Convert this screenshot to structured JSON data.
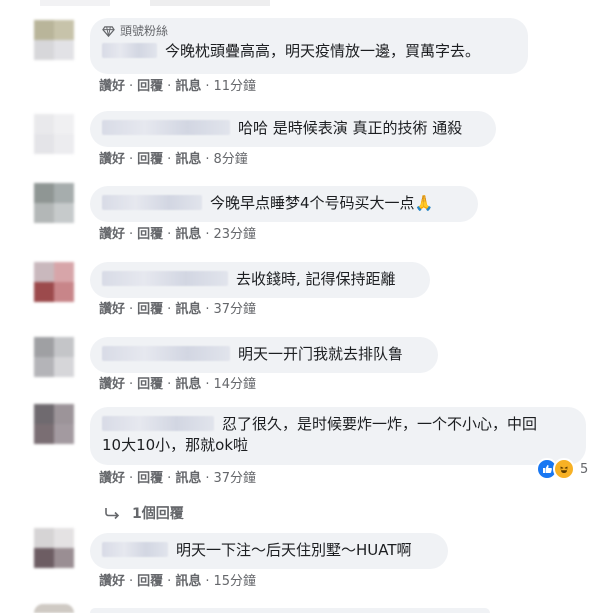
{
  "actions": {
    "like": "讚好",
    "reply": "回覆",
    "message": "訊息",
    "sep": "·"
  },
  "comments": [
    {
      "badge": "頭號粉絲",
      "text": "今晚枕頭疊高高，明天疫情放一邊，買萬字去。",
      "time": "11分鐘",
      "avatar_colors": [
        "#b9b59a",
        "#c7c3aa",
        "#d7d7da",
        "#e2e2e6"
      ]
    },
    {
      "text": "哈哈 是時候表演 真正的技術 通殺",
      "time": "8分鐘",
      "avatar_colors": [
        "#e9e9ec",
        "#f0f0f2",
        "#e4e4e8",
        "#ececef"
      ]
    },
    {
      "text": "今晚早点睡梦4个号码买大一点🙏",
      "time": "23分鐘",
      "avatar_colors": [
        "#8f9694",
        "#a6adad",
        "#b3b7b7",
        "#c6cacb"
      ]
    },
    {
      "text": "去收錢時, 記得保持距離",
      "time": "37分鐘",
      "avatar_colors": [
        "#c9b8bd",
        "#d7a5a9",
        "#9c4a4c",
        "#c88589"
      ]
    },
    {
      "text": "明天一开门我就去排队鲁",
      "time": "14分鐘",
      "avatar_colors": [
        "#9fa0a3",
        "#c4c5c8",
        "#b4b4b8",
        "#d6d6d9"
      ]
    },
    {
      "text_line1": "忍了很久，是时候要炸一炸，一个不小心，中回",
      "text_line2": "10大10小，那就ok啦",
      "time": "37分鐘",
      "avatar_colors": [
        "#6f6a6f",
        "#9c9499",
        "#7a6e73",
        "#a39aa0"
      ]
    },
    {
      "text": "明天一下注～后天住別墅～HUAT啊",
      "time": "15分鐘",
      "avatar_colors": [
        "#d6d4d5",
        "#e4e2e3",
        "#6d5d63",
        "#9a8e93"
      ]
    }
  ],
  "replies_label": "1個回覆",
  "reactions": {
    "count": "5",
    "icons": [
      "like-icon",
      "haha-icon"
    ],
    "like_color": "#1877f2",
    "haha_color": "#f7b125"
  }
}
